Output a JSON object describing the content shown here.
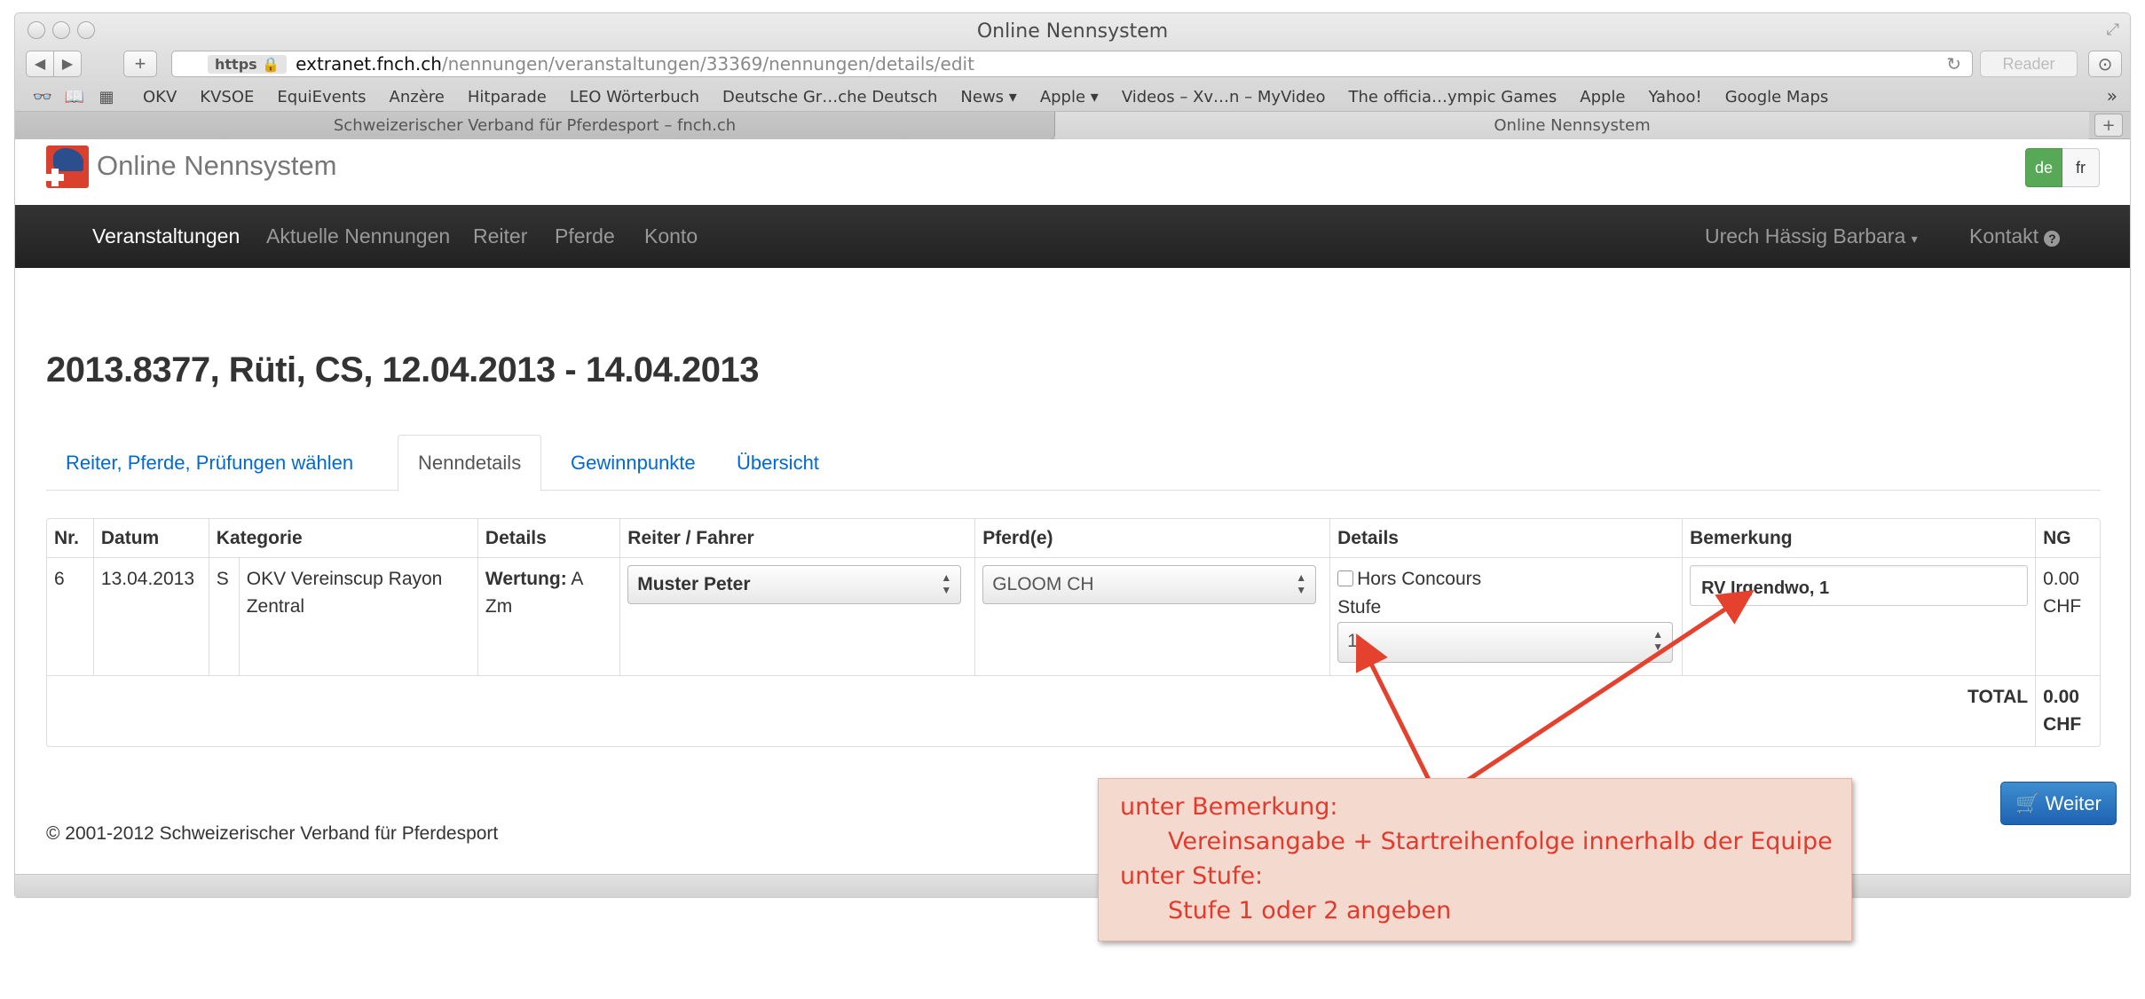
{
  "browser": {
    "window_title": "Online Nennsystem",
    "url_scheme": "https",
    "url_host": "extranet.fnch.ch",
    "url_path": "/nennungen/veranstaltungen/33369/nennungen/details/edit",
    "reader_label": "Reader",
    "bookmarks": [
      "OKV",
      "KVSOE",
      "EquiEvents",
      "Anzère",
      "Hitparade",
      "LEO Wörterbuch",
      "Deutsche Gr…che Deutsch",
      "News ▾",
      "Apple ▾",
      "Videos – Xv…n – MyVideo",
      "The officia…ympic Games",
      "Apple",
      "Yahoo!",
      "Google Maps"
    ],
    "tabs": [
      "Schweizerischer Verband für Pferdesport – fnch.ch",
      "Online Nennsystem"
    ]
  },
  "site": {
    "brand": "Online Nennsystem",
    "lang": [
      "de",
      "fr"
    ]
  },
  "nav": {
    "items": [
      "Veranstaltungen",
      "Aktuelle Nennungen",
      "Reiter",
      "Pferde",
      "Konto"
    ],
    "user": "Urech Hässig Barbara",
    "contact": "Kontakt"
  },
  "page": {
    "title": "2013.8377, Rüti, CS, 12.04.2013 - 14.04.2013",
    "tabs": [
      "Reiter, Pferde, Prüfungen wählen",
      "Nenndetails",
      "Gewinnpunkte",
      "Übersicht"
    ]
  },
  "table": {
    "headers": [
      "Nr.",
      "Datum",
      "Kategorie",
      "",
      "Details",
      "Reiter / Fahrer",
      "Pferd(e)",
      "Details",
      "Bemerkung",
      "NG"
    ],
    "row": {
      "nr": "6",
      "datum": "13.04.2013",
      "kat_code": "S",
      "kategorie": "OKV Vereinscup Rayon Zentral",
      "details_label": "Wertung:",
      "details_value": "A Zm",
      "reiter": "Muster Peter",
      "pferd": "GLOOM CH",
      "hors_concours": "Hors Concours",
      "stufe_label": "Stufe",
      "stufe_value": "1",
      "bemerkung": "RV Irgendwo, 1",
      "ng": "0.00 CHF"
    },
    "total_label": "TOTAL",
    "total_value": "0.00 CHF"
  },
  "footer": {
    "weiter": "Weiter",
    "copyright": "© 2001-2012 Schweizerischer Verband für Pferdesport"
  },
  "annotation": {
    "line1": "unter Bemerkung:",
    "line2": "Vereinsangabe + Startreihenfolge innerhalb der Equipe",
    "line3": "unter Stufe:",
    "line4": "Stufe 1 oder 2 angeben",
    "color": "#e23a2c"
  }
}
